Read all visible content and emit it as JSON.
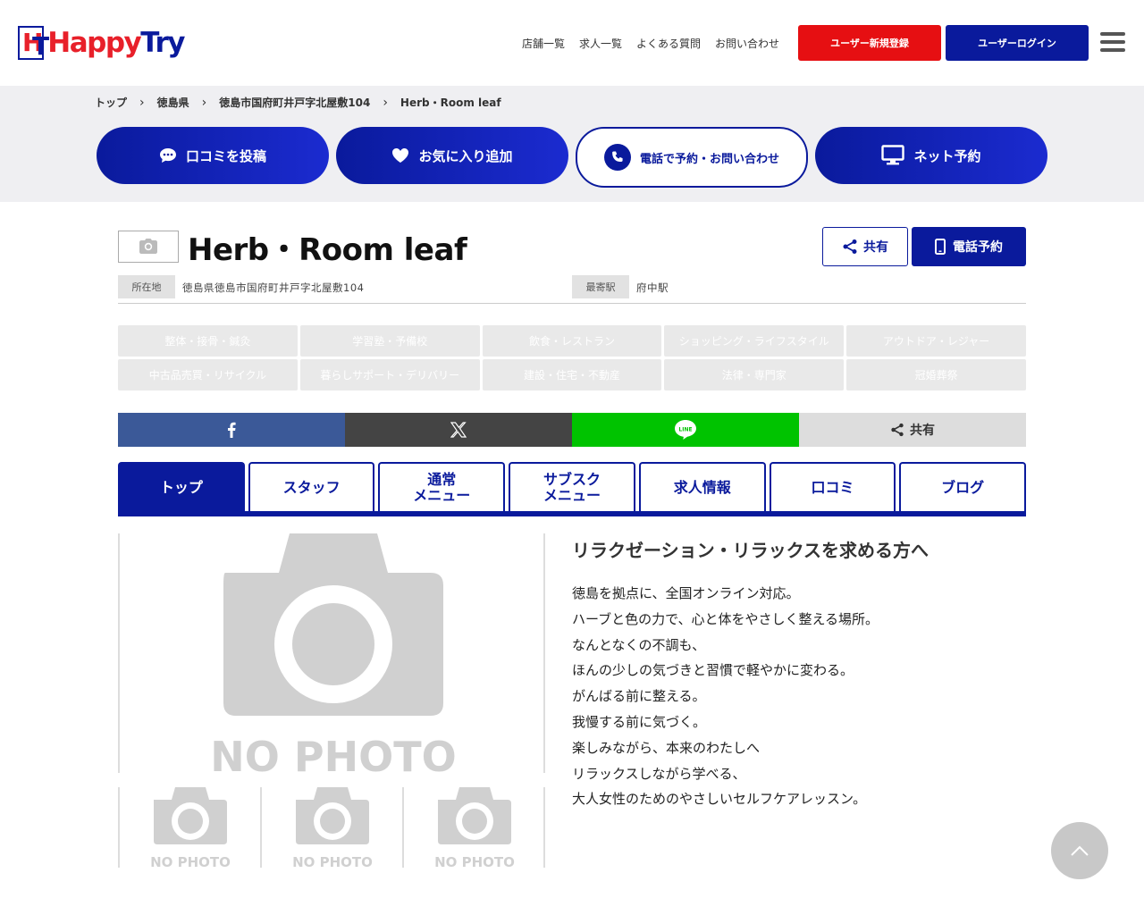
{
  "header": {
    "logo_text_happy": "Happy",
    "logo_text_try": "Try",
    "nav": [
      "店舗一覧",
      "求人一覧",
      "よくある質問",
      "お問い合わせ"
    ],
    "register_label": "ユーザー新規登録",
    "login_label": "ユーザーログイン"
  },
  "breadcrumb": [
    "トップ",
    "徳島県",
    "徳島市国府町井戸字北屋敷104",
    "Herb・Room leaf"
  ],
  "actions": {
    "review": "口コミを投稿",
    "favorite": "お気に入り追加",
    "phone": "電話で予約・お問い合わせ",
    "net": "ネット予約"
  },
  "shop": {
    "name": "Herb・Room leaf",
    "share_label": "共有",
    "phone_reserve_label": "電話予約",
    "address_label": "所在地",
    "address": "徳島県徳島市国府町井戸字北屋敷104",
    "station_label": "最寄駅",
    "station": "府中駅"
  },
  "categories": [
    "整体・接骨・鍼灸",
    "学習塾・予備校",
    "飲食・レストラン",
    "ショッピング・ライフスタイル",
    "アウトドア・レジャー",
    "中古品売買・リサイクル",
    "暮らしサポート・デリバリー",
    "建設・住宅・不動産",
    "法律・専門家",
    "冠婚葬祭"
  ],
  "social": {
    "share_label": "共有"
  },
  "tabs": [
    {
      "line1": "トップ",
      "line2": ""
    },
    {
      "line1": "スタッフ",
      "line2": ""
    },
    {
      "line1": "通常",
      "line2": "メニュー"
    },
    {
      "line1": "サブスク",
      "line2": "メニュー"
    },
    {
      "line1": "求人情報",
      "line2": ""
    },
    {
      "line1": "口コミ",
      "line2": ""
    },
    {
      "line1": "ブログ",
      "line2": ""
    }
  ],
  "photos": {
    "placeholder_text": "NO PHOTO"
  },
  "description": {
    "title": "リラクゼーション・リラックスを求める方へ",
    "lines": [
      "徳島を拠点に、全国オンライン対応。",
      "ハーブと色の力で、心と体をやさしく整える場所。",
      "なんとなくの不調も、",
      "ほんの少しの気づきと習慣で軽やかに変わる。",
      "がんばる前に整える。",
      "我慢する前に気づく。",
      "楽しみながら、本来のわたしへ",
      "リラックスしながら学べる、",
      "大人女性のためのやさしいセルフケアレッスン。"
    ]
  },
  "colors": {
    "brand_blue": "#0a1a9c",
    "brand_red": "#e60f12",
    "facebook": "#3b5998",
    "x": "#444444",
    "line": "#00c300"
  }
}
